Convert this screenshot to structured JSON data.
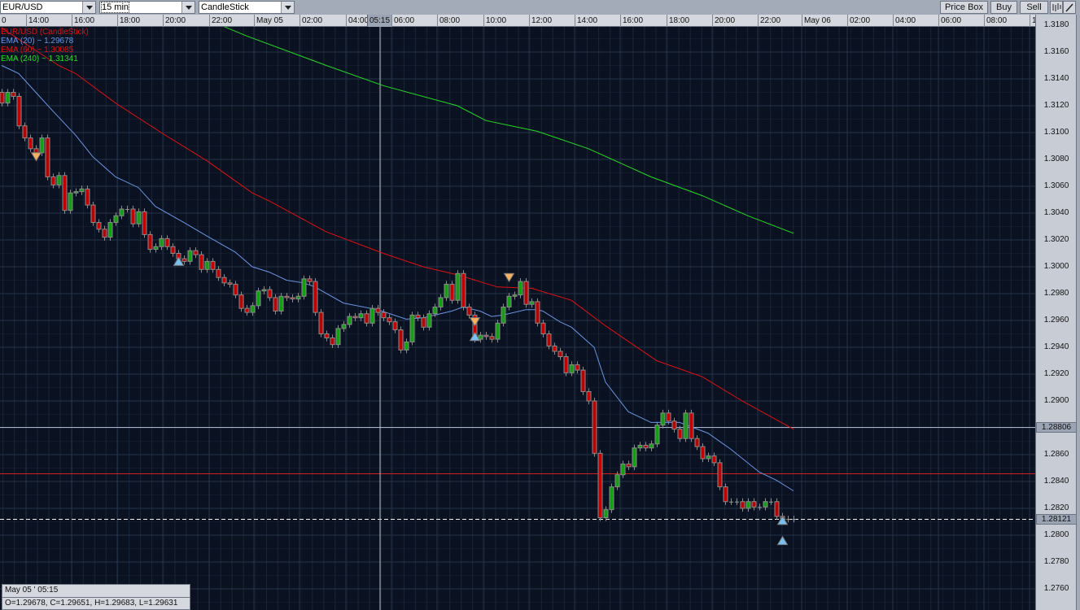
{
  "toolbar": {
    "symbol": "EUR/USD",
    "timeframe": "15 min",
    "chart_type": "CandleStick",
    "price_box_label": "Price Box",
    "buy_label": "Buy",
    "sell_label": "Sell"
  },
  "time_axis": {
    "labels": [
      "0",
      "14:00",
      "16:00",
      "18:00",
      "20:00",
      "22:00",
      "May 05",
      "02:00",
      "04:00",
      "06:00",
      "08:00",
      "10:00",
      "12:00",
      "14:00",
      "16:00",
      "18:00",
      "20:00",
      "22:00",
      "May 06",
      "02:00",
      "04:00",
      "06:00",
      "08:00",
      "1"
    ],
    "crosshair_label": "05:15"
  },
  "price_axis": {
    "ticks": [
      "1.3180",
      "1.3160",
      "1.3140",
      "1.3120",
      "1.3100",
      "1.3080",
      "1.3060",
      "1.3040",
      "1.3020",
      "1.3000",
      "1.2980",
      "1.2960",
      "1.2940",
      "1.2920",
      "1.2900",
      "1.2880",
      "1.2860",
      "1.2840",
      "1.2820",
      "1.2800",
      "1.2780",
      "1.2760"
    ],
    "level_label": "1.28806",
    "current_label": "1.28121"
  },
  "legend": {
    "title": "EUR/USD (CandleStick)",
    "ema20": "EMA (20) ~ 1.29678",
    "ema60": "EMA (60) ~ 1.30085",
    "ema240": "EMA (240) ~ 1.31341"
  },
  "info": {
    "time": "May 05 ' 05:15",
    "ohlc": "O=1.29678, C=1.29651, H=1.29683, L=1.29631"
  },
  "colors": {
    "bull": "#12a012",
    "bear": "#c00000",
    "ema20": "#6b96e6",
    "ema60": "#e01010",
    "ema240": "#22dd22",
    "sell_marker": "#f5b060",
    "buy_marker": "#78c0f0"
  },
  "chart_data": {
    "type": "candlestick",
    "interval": "15 min",
    "first_open": 1.313,
    "closes": [
      1.3122,
      1.313,
      1.3127,
      1.3105,
      1.3096,
      1.3088,
      1.3085,
      1.3096,
      1.3067,
      1.3061,
      1.3068,
      1.3042,
      1.3055,
      1.3056,
      1.3058,
      1.3046,
      1.3033,
      1.3028,
      1.3022,
      1.3033,
      1.3038,
      1.3043,
      1.3043,
      1.3032,
      1.3041,
      1.3024,
      1.3013,
      1.3015,
      1.3021,
      1.3015,
      1.301,
      1.3006,
      1.3004,
      1.3012,
      1.3009,
      1.2998,
      1.3004,
      1.2998,
      1.2992,
      1.2988,
      1.2987,
      1.2979,
      1.2969,
      1.2966,
      1.2971,
      1.2982,
      1.2983,
      1.2977,
      1.2967,
      1.2978,
      1.2977,
      1.2976,
      1.2978,
      1.2991,
      1.2989,
      1.2966,
      1.295,
      1.2947,
      1.2942,
      1.2954,
      1.2957,
      1.2963,
      1.2962,
      1.2965,
      1.2958,
      1.2969,
      1.2966,
      1.2962,
      1.2959,
      1.2953,
      1.2938,
      1.2944,
      1.2964,
      1.2962,
      1.2955,
      1.2965,
      1.297,
      1.2977,
      1.2987,
      1.2975,
      1.2995,
      1.297,
      1.2964,
      1.2946,
      1.2949,
      1.2948,
      1.2946,
      1.2958,
      1.297,
      1.2978,
      1.2979,
      1.2989,
      1.2972,
      1.2974,
      1.2958,
      1.295,
      1.2941,
      1.2937,
      1.2933,
      1.2921,
      1.2927,
      1.2923,
      1.2907,
      1.29,
      1.2861,
      1.2813,
      1.2819,
      1.2836,
      1.2845,
      1.2853,
      1.2851,
      1.2865,
      1.2867,
      1.2865,
      1.2868,
      1.2882,
      1.2891,
      1.2885,
      1.2879,
      1.2872,
      1.2891,
      1.2872,
      1.2866,
      1.2857,
      1.2859,
      1.2854,
      1.2836,
      1.2825,
      1.2825,
      1.2825,
      1.282,
      1.2825,
      1.2821,
      1.2821,
      1.2825,
      1.2825,
      1.2814,
      1.2812,
      1.2812,
      1.2812
    ],
    "ema20": [
      [
        0,
        1.315
      ],
      [
        3,
        1.3144
      ],
      [
        6,
        1.313
      ],
      [
        9,
        1.3116
      ],
      [
        13,
        1.3098
      ],
      [
        16,
        1.3082
      ],
      [
        20,
        1.3067
      ],
      [
        24,
        1.3059
      ],
      [
        27,
        1.3045
      ],
      [
        32,
        1.3033
      ],
      [
        36,
        1.3023
      ],
      [
        41,
        1.3011
      ],
      [
        44,
        1.3
      ],
      [
        47,
        1.2996
      ],
      [
        50,
        1.299
      ],
      [
        53,
        1.2988
      ],
      [
        55,
        1.2985
      ],
      [
        60,
        1.2973
      ],
      [
        66,
        1.2968
      ],
      [
        71,
        1.2961
      ],
      [
        74,
        1.2962
      ],
      [
        79,
        1.2967
      ],
      [
        81,
        1.297
      ],
      [
        84,
        1.2967
      ],
      [
        86,
        1.2963
      ],
      [
        88,
        1.2964
      ],
      [
        92,
        1.2968
      ],
      [
        94,
        1.2968
      ],
      [
        95,
        1.2967
      ],
      [
        98,
        1.2959
      ],
      [
        100,
        1.2955
      ],
      [
        104,
        1.294
      ],
      [
        106,
        1.2914
      ],
      [
        110,
        1.2892
      ],
      [
        114,
        1.2884
      ],
      [
        119,
        1.2884
      ],
      [
        124,
        1.2876
      ],
      [
        128,
        1.2864
      ],
      [
        133,
        1.2847
      ],
      [
        136,
        1.2841
      ],
      [
        139,
        1.2833
      ]
    ],
    "ema60": [
      [
        0,
        1.3178
      ],
      [
        10,
        1.315
      ],
      [
        13,
        1.3144
      ],
      [
        20,
        1.3122
      ],
      [
        28,
        1.31
      ],
      [
        36,
        1.3079
      ],
      [
        44,
        1.3055
      ],
      [
        47,
        1.3049
      ],
      [
        57,
        1.3026
      ],
      [
        67,
        1.301
      ],
      [
        74,
        1.3
      ],
      [
        80,
        1.2994
      ],
      [
        87,
        1.2985
      ],
      [
        93,
        1.2984
      ],
      [
        100,
        1.2975
      ],
      [
        106,
        1.2956
      ],
      [
        115,
        1.293
      ],
      [
        123,
        1.2918
      ],
      [
        130,
        1.29
      ],
      [
        139,
        1.2879
      ]
    ],
    "ema240": [
      [
        39,
        1.3179
      ],
      [
        43,
        1.3172
      ],
      [
        57,
        1.315
      ],
      [
        67,
        1.3135
      ],
      [
        80,
        1.312
      ],
      [
        85,
        1.3109
      ],
      [
        94,
        1.3101
      ],
      [
        103,
        1.3088
      ],
      [
        114,
        1.3067
      ],
      [
        123,
        1.3053
      ],
      [
        131,
        1.3038
      ],
      [
        139,
        1.3025
      ]
    ],
    "signals": [
      {
        "type": "sell",
        "bar": 6,
        "price": 1.3082
      },
      {
        "type": "buy",
        "bar": 31,
        "price": 1.3004
      },
      {
        "type": "sell",
        "bar": 83,
        "price": 1.2959
      },
      {
        "type": "buy",
        "bar": 83,
        "price": 1.2948
      },
      {
        "type": "sell",
        "bar": 89,
        "price": 1.2992
      },
      {
        "type": "buy",
        "bar": 137,
        "price": 1.2811
      },
      {
        "type": "buy",
        "bar": 137,
        "price": 1.2796
      }
    ],
    "horizontal_levels": [
      {
        "price": 1.28806,
        "color": "#aab4c8",
        "style": "solid"
      },
      {
        "price": 1.2846,
        "color": "#d02020",
        "style": "solid"
      },
      {
        "price": 1.28121,
        "color": "#ffffff",
        "style": "dashed"
      }
    ],
    "crosshair_bar": 66.4,
    "ylim": [
      1.275,
      1.319
    ]
  }
}
